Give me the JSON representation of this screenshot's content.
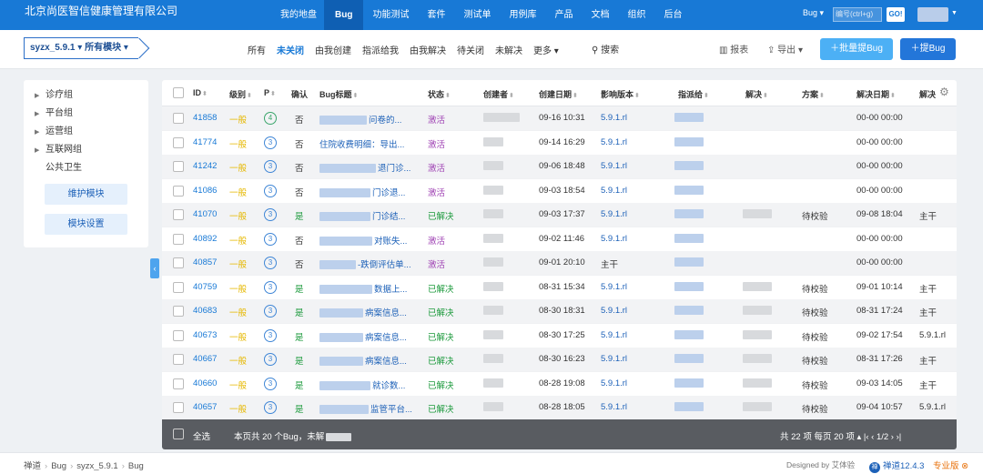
{
  "header": {
    "brand": "北京尚医智信健康管理有限公司",
    "nav": [
      {
        "label": "我的地盘",
        "active": false
      },
      {
        "label": "Bug",
        "active": true
      },
      {
        "label": "功能测试",
        "active": false
      },
      {
        "label": "套件",
        "active": false
      },
      {
        "label": "测试单",
        "active": false
      },
      {
        "label": "用例库",
        "active": false
      },
      {
        "label": "产品",
        "active": false
      },
      {
        "label": "文档",
        "active": false
      },
      {
        "label": "组织",
        "active": false
      },
      {
        "label": "后台",
        "active": false
      }
    ],
    "search_type": "Bug ▾",
    "search_placeholder": "编号(ctrl+g)",
    "go_label": "GO!"
  },
  "toolbar": {
    "product": "syzx_5.9.1 ▾  所有模块 ▾",
    "filters": [
      {
        "label": "所有",
        "active": false
      },
      {
        "label": "未关闭",
        "active": true
      },
      {
        "label": "由我创建",
        "active": false
      },
      {
        "label": "指派给我",
        "active": false
      },
      {
        "label": "由我解决",
        "active": false
      },
      {
        "label": "待关闭",
        "active": false
      },
      {
        "label": "未解决",
        "active": false
      },
      {
        "label": "更多 ▾",
        "active": false
      }
    ],
    "search": "搜索",
    "report": "报表",
    "export": "导出 ▾",
    "batch_add": "＋批量提Bug",
    "add": "＋提Bug"
  },
  "sidebar": {
    "modules": [
      {
        "label": "诊疗组",
        "expandable": true
      },
      {
        "label": "平台组",
        "expandable": true
      },
      {
        "label": "运营组",
        "expandable": true
      },
      {
        "label": "互联网组",
        "expandable": true
      },
      {
        "label": "公共卫生",
        "expandable": false
      }
    ],
    "maintain_btn": "维护模块",
    "settings_btn": "模块设置"
  },
  "table": {
    "columns": [
      "ID",
      "级别",
      "P",
      "确认",
      "Bug标题",
      "状态",
      "创建者",
      "创建日期",
      "影响版本",
      "指派给",
      "解决",
      "方案",
      "解决日期",
      "解决"
    ],
    "rows": [
      {
        "id": "41858",
        "level": "一般",
        "pri": "4",
        "confirmed": "否",
        "title_prefix": 52,
        "title": "问卷的...",
        "status": "激活",
        "date": "09-16 10:31",
        "version": "5.9.1.rl",
        "resolver": false,
        "plan": "",
        "rdate": "00-00 00:00",
        "rver": ""
      },
      {
        "id": "41774",
        "level": "一般",
        "pri": "3",
        "confirmed": "否",
        "title_prefix": 0,
        "title": "住院收费明细：导出...",
        "status": "激活",
        "date": "09-14 16:29",
        "version": "5.9.1.rl",
        "resolver": false,
        "plan": "",
        "rdate": "00-00 00:00",
        "rver": ""
      },
      {
        "id": "41242",
        "level": "一般",
        "pri": "3",
        "confirmed": "否",
        "title_prefix": 62,
        "title": "退门诊...",
        "status": "激活",
        "date": "09-06 18:48",
        "version": "5.9.1.rl",
        "resolver": false,
        "plan": "",
        "rdate": "00-00 00:00",
        "rver": ""
      },
      {
        "id": "41086",
        "level": "一般",
        "pri": "3",
        "confirmed": "否",
        "title_prefix": 56,
        "title": "门诊退...",
        "status": "激活",
        "date": "09-03 18:54",
        "version": "5.9.1.rl",
        "resolver": false,
        "plan": "",
        "rdate": "00-00 00:00",
        "rver": ""
      },
      {
        "id": "41070",
        "level": "一般",
        "pri": "3",
        "confirmed": "是",
        "title_prefix": 56,
        "title": "门诊结...",
        "status": "已解决",
        "date": "09-03 17:37",
        "version": "5.9.1.rl",
        "resolver": true,
        "plan": "待校验",
        "rdate": "09-08 18:04",
        "rver": "主干"
      },
      {
        "id": "40892",
        "level": "一般",
        "pri": "3",
        "confirmed": "否",
        "title_prefix": 58,
        "title": "对账失...",
        "status": "激活",
        "date": "09-02 11:46",
        "version": "5.9.1.rl",
        "resolver": false,
        "plan": "",
        "rdate": "00-00 00:00",
        "rver": ""
      },
      {
        "id": "40857",
        "level": "一般",
        "pri": "3",
        "confirmed": "否",
        "title_prefix": 40,
        "title": "-跌倒评估单...",
        "status": "激活",
        "date": "09-01 20:10",
        "version": "主干",
        "resolver": false,
        "plan": "",
        "rdate": "00-00 00:00",
        "rver": ""
      },
      {
        "id": "40759",
        "level": "一般",
        "pri": "3",
        "confirmed": "是",
        "title_prefix": 58,
        "title": "数据上...",
        "status": "已解决",
        "date": "08-31 15:34",
        "version": "5.9.1.rl",
        "resolver": true,
        "plan": "待校验",
        "rdate": "09-01 10:14",
        "rver": "主干"
      },
      {
        "id": "40683",
        "level": "一般",
        "pri": "3",
        "confirmed": "是",
        "title_prefix": 48,
        "title": "病案信息...",
        "status": "已解决",
        "date": "08-30 18:31",
        "version": "5.9.1.rl",
        "resolver": true,
        "plan": "待校验",
        "rdate": "08-31 17:24",
        "rver": "主干"
      },
      {
        "id": "40673",
        "level": "一般",
        "pri": "3",
        "confirmed": "是",
        "title_prefix": 48,
        "title": "病案信息...",
        "status": "已解决",
        "date": "08-30 17:25",
        "version": "5.9.1.rl",
        "resolver": true,
        "plan": "待校验",
        "rdate": "09-02 17:54",
        "rver": "5.9.1.rl"
      },
      {
        "id": "40667",
        "level": "一般",
        "pri": "3",
        "confirmed": "是",
        "title_prefix": 48,
        "title": "病案信息...",
        "status": "已解决",
        "date": "08-30 16:23",
        "version": "5.9.1.rl",
        "resolver": true,
        "plan": "待校验",
        "rdate": "08-31 17:26",
        "rver": "主干"
      },
      {
        "id": "40660",
        "level": "一般",
        "pri": "3",
        "confirmed": "是",
        "title_prefix": 56,
        "title": "就诊数...",
        "status": "已解决",
        "date": "08-28 19:08",
        "version": "5.9.1.rl",
        "resolver": true,
        "plan": "待校验",
        "rdate": "09-03 14:05",
        "rver": "主干"
      },
      {
        "id": "40657",
        "level": "一般",
        "pri": "3",
        "confirmed": "是",
        "title_prefix": 54,
        "title": "监管平台...",
        "status": "已解决",
        "date": "08-28 18:05",
        "version": "5.9.1.rl",
        "resolver": true,
        "plan": "待校验",
        "rdate": "09-04 10:57",
        "rver": "5.9.1.rl"
      }
    ],
    "footer": {
      "select_all": "全选",
      "summary": "本页共 20 个Bug，未解",
      "pager": "共 22 项   每页 20 项 ▴   |‹   ‹   1/2   ›   ›|"
    }
  },
  "statusbar": {
    "crumbs": [
      "禅道",
      "Bug",
      "syzx_5.9.1",
      "Bug"
    ],
    "designed_by": "Designed by 艾体验",
    "version": "禅道12.4.3",
    "edition": "专业版 ⊗"
  }
}
